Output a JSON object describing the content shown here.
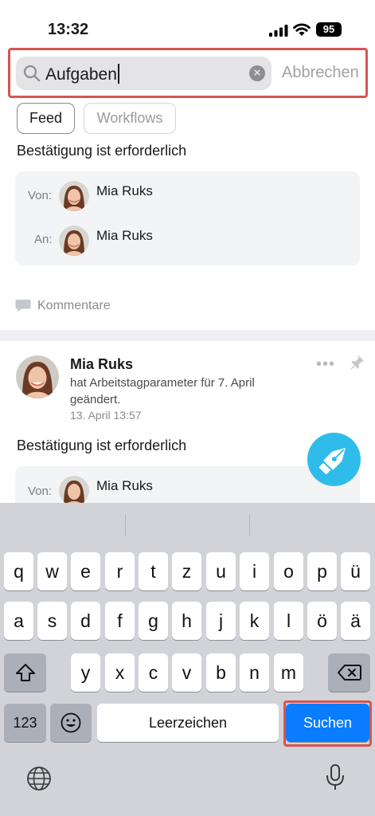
{
  "status_bar": {
    "time": "13:32",
    "battery": "95"
  },
  "search": {
    "query": "Aufgaben",
    "cancel_label": "Abbrechen"
  },
  "filters": [
    {
      "label": "Feed",
      "selected": true
    },
    {
      "label": "Workflows",
      "selected": false
    }
  ],
  "post1": {
    "title": "Bestätigung ist erforderlich",
    "from_label": "Von:",
    "from_name": "Mia Ruks",
    "to_label": "An:",
    "to_name": "Mia Ruks",
    "comments_label": "Kommentare"
  },
  "post2": {
    "author": "Mia Ruks",
    "action": "hat Arbeitstagparameter für 7. April geändert.",
    "date": "13. April 13:57",
    "title": "Bestätigung ist erforderlich",
    "from_label": "Von:",
    "from_name": "Mia Ruks"
  },
  "keyboard": {
    "row1": [
      "q",
      "w",
      "e",
      "r",
      "t",
      "z",
      "u",
      "i",
      "o",
      "p",
      "ü"
    ],
    "row2": [
      "a",
      "s",
      "d",
      "f",
      "g",
      "h",
      "j",
      "k",
      "l",
      "ö",
      "ä"
    ],
    "row3": [
      "y",
      "x",
      "c",
      "v",
      "b",
      "n",
      "m"
    ],
    "numbers_label": "123",
    "space_label": "Leerzeichen",
    "search_label": "Suchen"
  },
  "colors": {
    "accent": "#0a7cff",
    "fab": "#2fbcea",
    "highlight": "#d9534f"
  }
}
